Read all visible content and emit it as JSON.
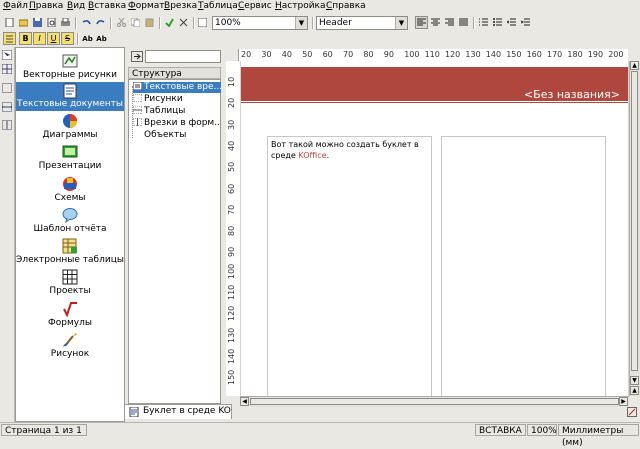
{
  "menu": [
    "Файл",
    "Правка",
    "Вид",
    "Вставка",
    "Формат",
    "Врезка",
    "Таблица",
    "Сервис",
    "Настройка",
    "Справка"
  ],
  "toolbar": {
    "zoom": "100%",
    "style": "Header"
  },
  "format_toolbar": {
    "bold": "B",
    "italic": "I",
    "underline": "U",
    "strike": "S",
    "superscript": "Ab",
    "subscript": "Ab"
  },
  "sidebar": {
    "items": [
      {
        "label": "Векторные рисунки",
        "icon": "vector-drawing-icon"
      },
      {
        "label": "Текстовые документы",
        "icon": "text-document-icon"
      },
      {
        "label": "Диаграммы",
        "icon": "chart-icon"
      },
      {
        "label": "Презентации",
        "icon": "presentation-icon"
      },
      {
        "label": "Схемы",
        "icon": "flowchart-icon"
      },
      {
        "label": "Шаблон отчёта",
        "icon": "report-template-icon"
      },
      {
        "label": "Электронные таблицы",
        "icon": "spreadsheet-icon"
      },
      {
        "label": "Проекты",
        "icon": "project-icon"
      },
      {
        "label": "Формулы",
        "icon": "formula-icon"
      },
      {
        "label": "Рисунок",
        "icon": "image-icon"
      }
    ],
    "selected": 1
  },
  "tree": {
    "header": "Структура документа",
    "items": [
      "Текстовые вре...",
      "Рисунки",
      "Таблицы",
      "Врезки в форм...",
      "Объекты"
    ]
  },
  "ruler": {
    "h": [
      "20",
      "30",
      "40",
      "50",
      "60",
      "70",
      "80",
      "90",
      "100",
      "110",
      "120",
      "130",
      "140",
      "150",
      "160",
      "170",
      "180",
      "190",
      "200"
    ],
    "v": [
      "10",
      "20",
      "30",
      "40",
      "50",
      "60",
      "70",
      "80",
      "90",
      "100",
      "110",
      "120",
      "130",
      "140",
      "150"
    ]
  },
  "document": {
    "title": "<Без названия>",
    "text_a": "Вот такой можно создать буклет в среде ",
    "text_b": "KOffice",
    "text_c": ".",
    "tab_label": "Буклет в среде KO..."
  },
  "status": {
    "page": "Страница 1 из 1",
    "mode": "ВСТАВКА",
    "zoom": "100%",
    "units": "Миллиметры (мм)"
  },
  "colors": {
    "banner": "#b0473f",
    "selection": "#3a7cc0"
  }
}
